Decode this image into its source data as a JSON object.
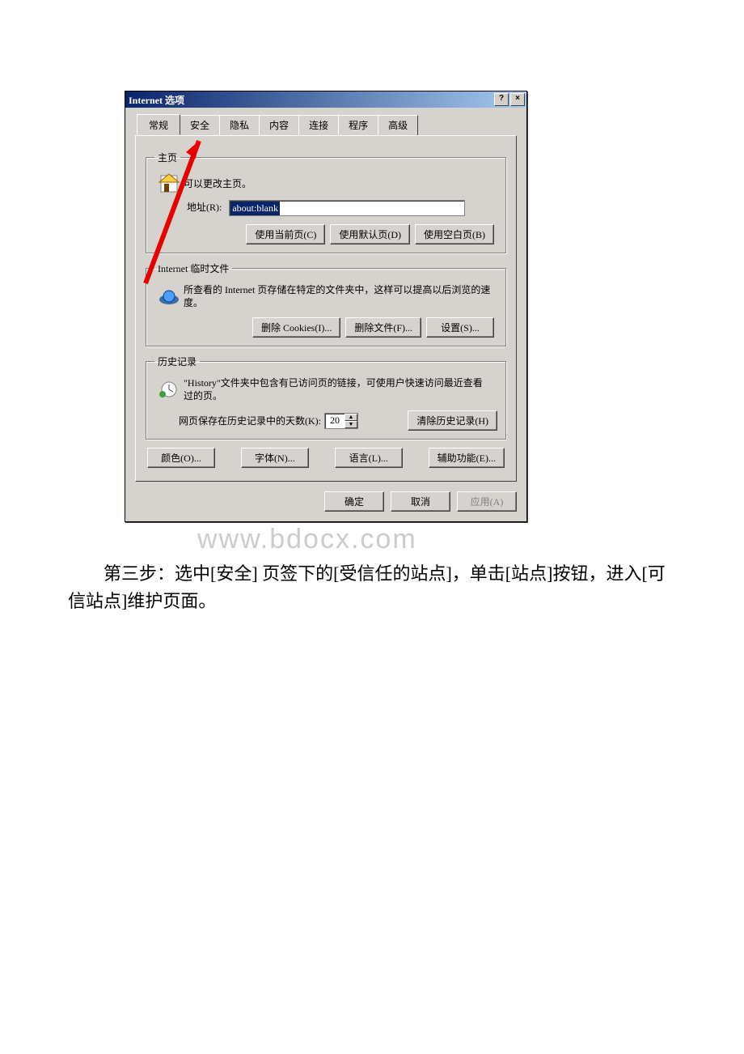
{
  "dialog": {
    "title": "Internet 选项",
    "help_btn": "?",
    "close_btn": "×",
    "tabs": [
      "常规",
      "安全",
      "隐私",
      "内容",
      "连接",
      "程序",
      "高级"
    ],
    "active_tab_index": 0
  },
  "home": {
    "legend": "主页",
    "desc": "可以更改主页。",
    "addr_label": "地址(R):",
    "addr_value": "about:blank",
    "btn_current": "使用当前页(C)",
    "btn_default": "使用默认页(D)",
    "btn_blank": "使用空白页(B)"
  },
  "temp": {
    "legend": "Internet 临时文件",
    "desc": "所查看的 Internet 页存储在特定的文件夹中，这样可以提高以后浏览的速度。",
    "btn_cookies": "删除 Cookies(I)...",
    "btn_files": "删除文件(F)...",
    "btn_settings": "设置(S)..."
  },
  "history": {
    "legend": "历史记录",
    "desc": "\"History\"文件夹中包含有已访问页的链接，可使用户快速访问最近查看过的页。",
    "days_label": "网页保存在历史记录中的天数(K):",
    "days_value": "20",
    "btn_clear": "清除历史记录(H)"
  },
  "footer": {
    "btn_colors": "颜色(O)...",
    "btn_fonts": "字体(N)...",
    "btn_lang": "语言(L)...",
    "btn_access": "辅助功能(E)..."
  },
  "dialog_buttons": {
    "ok": "确定",
    "cancel": "取消",
    "apply": "应用(A)"
  },
  "watermark": "www.bdocx.com",
  "instruction": "　　第三步：选中[安全] 页签下的[受信任的站点]，单击[站点]按钮，进入[可信站点]维护页面。"
}
